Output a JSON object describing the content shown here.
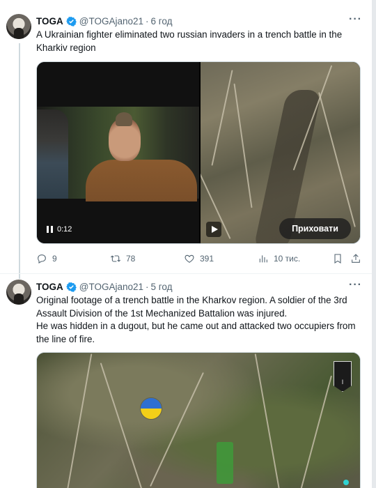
{
  "tweets": [
    {
      "author": {
        "name": "TOGA",
        "handle": "@TOGAjano21",
        "time": "6 год"
      },
      "text": "A Ukrainian fighter eliminated two russian invaders in a trench battle in the Kharkiv region",
      "media": {
        "duration": "0:12",
        "hide_button": "Приховати"
      },
      "stats": {
        "replies": "9",
        "retweets": "78",
        "likes": "391",
        "views": "10 тис."
      }
    },
    {
      "author": {
        "name": "TOGA",
        "handle": "@TOGAjano21",
        "time": "5 год"
      },
      "text_lines": [
        "Original footage of a trench battle in the Kharkov region. A soldier of the 3rd Assault Division of the 1st Mechanized Battalion was injured.",
        "He was hidden in a dugout, but he came out and attacked two occupiers from the line of fire."
      ]
    }
  ],
  "colors": {
    "verified": "#1d9bf0",
    "muted": "#536471",
    "text": "#0f1419"
  },
  "icons": [
    "verified-badge-icon",
    "more-icon",
    "reply-icon",
    "retweet-icon",
    "like-icon",
    "views-icon",
    "bookmark-icon",
    "share-icon",
    "pause-icon",
    "play-icon"
  ]
}
